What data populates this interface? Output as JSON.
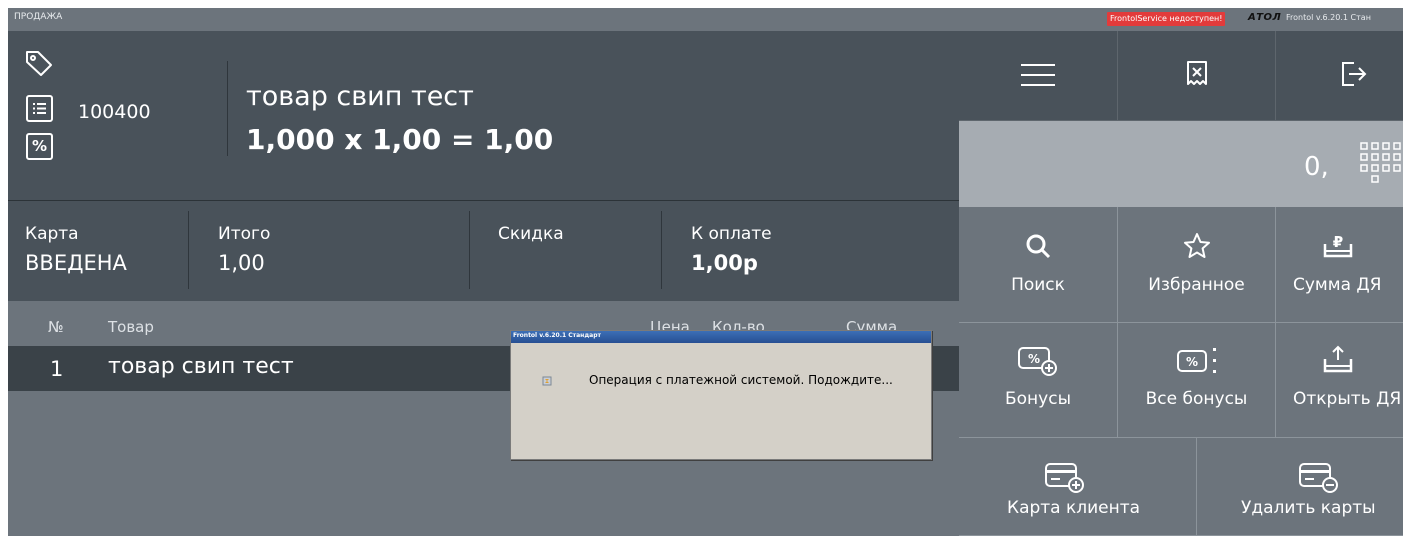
{
  "window": {
    "title": "ПРОДАЖА",
    "service_status": "FrontolService недоступен!",
    "vendor_logo": "АТОЛ",
    "version": "Frontol v.6.20.1 Стан",
    "status_color": "#e23b3b"
  },
  "current_item": {
    "code": "100400",
    "name": "товар свип тест",
    "calculation": "1,000 x 1,00 = 1,00"
  },
  "totals": {
    "card_label": "Карта",
    "card_value": "ВВЕДЕНА",
    "total_label": "Итого",
    "total_value": "1,00",
    "discount_label": "Скидка",
    "discount_value": "",
    "due_label": "К оплате",
    "due_value": "1,00р"
  },
  "table": {
    "columns": [
      "№",
      "Товар",
      "Цена",
      "Кол-во",
      "Сумма"
    ],
    "rows": [
      {
        "num": "1",
        "name": "товар свип тест"
      }
    ]
  },
  "right_panel": {
    "amount": "0,",
    "buttons": {
      "search": "Поиск",
      "favorites": "Избранное",
      "sum_da": "Сумма ДЯ",
      "bonuses": "Бонусы",
      "all_bonuses": "Все бонусы",
      "open_da": "Открыть ДЯ",
      "client_card": "Карта клиента",
      "delete_cards": "Удалить карты"
    },
    "top_icons": [
      "menu-icon",
      "cancel-receipt-icon",
      "exit-icon"
    ]
  },
  "dialog": {
    "title": "Frontol v.6.20.1 Стандарт",
    "message": "Операция с платежной системой. Подождите..."
  }
}
